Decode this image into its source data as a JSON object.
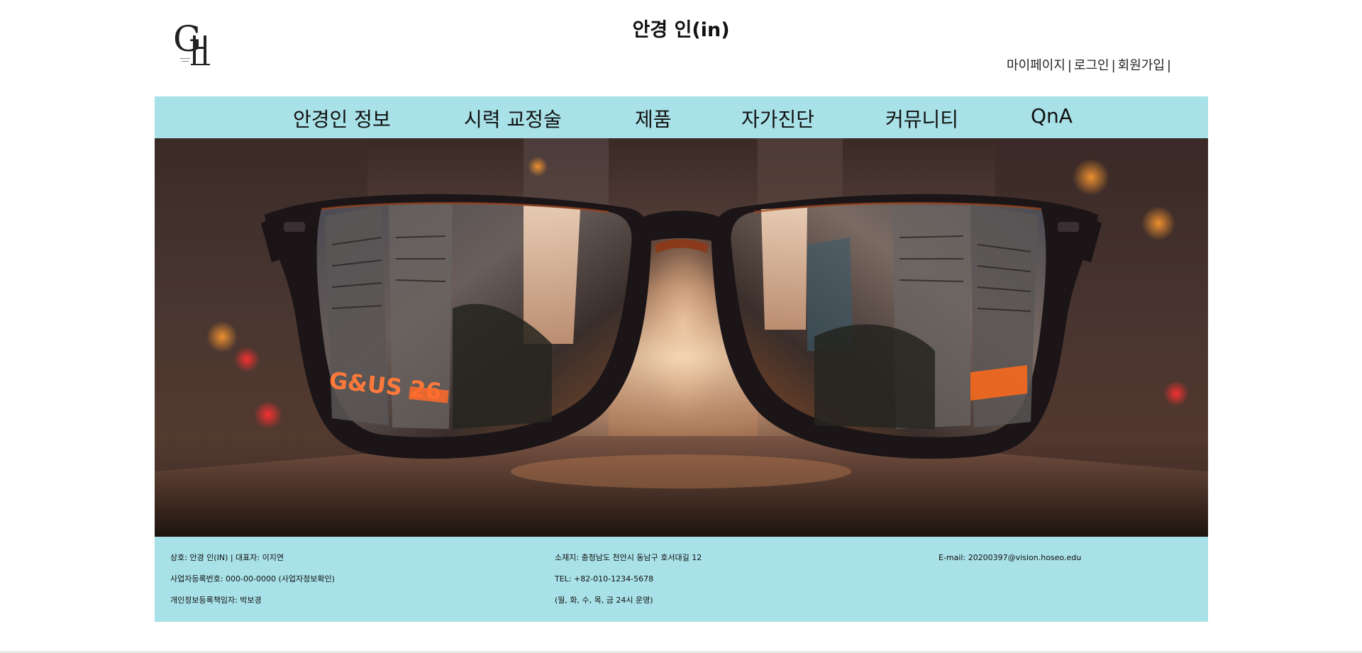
{
  "header": {
    "site_title": "안경 인(in)",
    "logo_icon": "gh-monogram-logo",
    "user_links": [
      {
        "label": "마이페이지"
      },
      {
        "label": "로그인"
      },
      {
        "label": "회원가입"
      }
    ],
    "separator": "|"
  },
  "nav": {
    "items": [
      {
        "label": "안경인 정보"
      },
      {
        "label": "시력 교정술"
      },
      {
        "label": "제품"
      },
      {
        "label": "자가진단"
      },
      {
        "label": "커뮤니티"
      },
      {
        "label": "QnA"
      }
    ]
  },
  "hero": {
    "image_subject": "eyeglasses-city-street-photo",
    "sign_text": "G&US 26"
  },
  "footer": {
    "col1": [
      "상호: 안경 인(IN) | 대표자: 이지연",
      "사업자등록번호: 000-00-0000 (사업자정보확인)",
      "개인정보등록책임자: 박보경"
    ],
    "col2": [
      "소재지: 충청남도 천안시 동남구 호서대길 12",
      "TEL: +82-010-1234-5678",
      "(월, 화, 수, 목, 금 24시 운영)"
    ],
    "col3": [
      "E-mail: 20200397@vision.hoseo.edu"
    ]
  },
  "colors": {
    "accent": "#a8e1e7",
    "text": "#111111"
  }
}
